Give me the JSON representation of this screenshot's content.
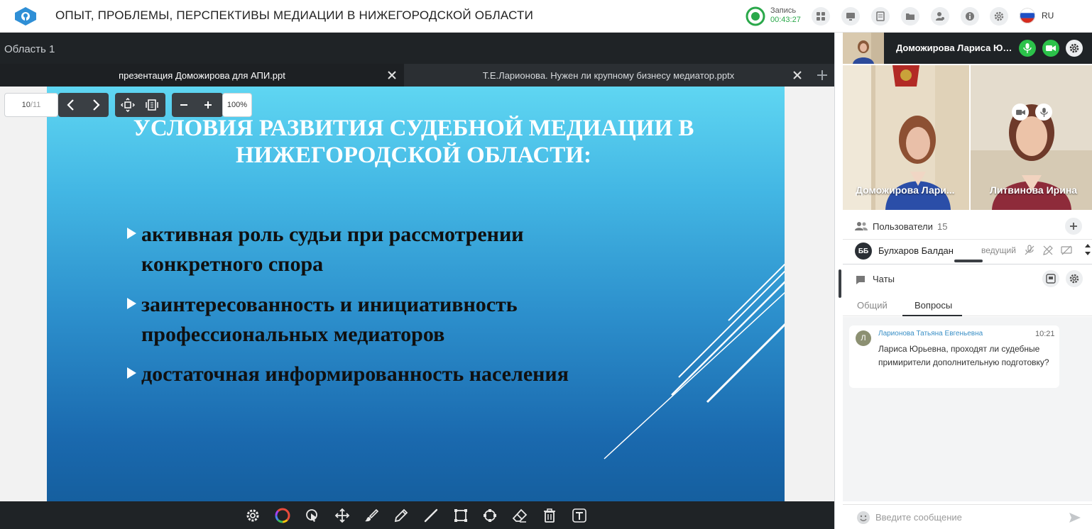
{
  "header": {
    "title": "ОПЫТ, ПРОБЛЕМЫ, ПЕРСПЕКТИВЫ МЕДИАЦИИ В НИЖЕГОРОДСКОЙ ОБЛАСТИ",
    "recording_label": "Запись",
    "recording_time": "00:43:27",
    "language": "RU",
    "icons": [
      "apps-icon",
      "screen-icon",
      "document-icon",
      "folder-icon",
      "user-settings-icon",
      "info-icon",
      "gear-icon"
    ],
    "accent_color": "#2aa84a"
  },
  "area": {
    "label": "Область 1"
  },
  "tabs": [
    {
      "label": "презентация Доможирова для АПИ.ppt",
      "active": true
    },
    {
      "label": "Т.Е.Ларионова. Нужен ли крупному бизнесу медиатор.pptx",
      "active": false
    }
  ],
  "slide_controls": {
    "page_current": "10",
    "page_total": "/11",
    "zoom": "100%"
  },
  "slide": {
    "title_line1": "УСЛОВИЯ РАЗВИТИЯ СУДЕБНОЙ МЕДИАЦИИ В",
    "title_line2": "НИЖЕГОРОДСКОЙ ОБЛАСТИ:",
    "bullets": [
      {
        "line1": "активная роль судьи при рассмотрении",
        "line2": "конкретного спора"
      },
      {
        "line1": "заинтересованность и инициативность",
        "line2": "профессиональных медиаторов"
      },
      {
        "line1": "достаточная информированность населения",
        "line2": ""
      }
    ]
  },
  "toolbar": {
    "tools": [
      "settings-tool",
      "color-tool",
      "pointer-tool",
      "move-tool",
      "brush-tool",
      "pen-tool",
      "line-tool",
      "rectangle-tool",
      "ellipse-tool",
      "eraser-tool",
      "trash-tool",
      "text-tool"
    ]
  },
  "speaker": {
    "name": "Доможирова Лариса Юрь..."
  },
  "videos": [
    {
      "name": "Доможирова Лари..."
    },
    {
      "name": "Литвинова Ирина"
    }
  ],
  "users": {
    "label": "Пользователи",
    "count": "15",
    "first_user": {
      "initials": "ББ",
      "name": "Булхаров Балдан",
      "role": "ведущий"
    }
  },
  "chats": {
    "label": "Чаты",
    "tabs": [
      {
        "label": "Общий",
        "active": false
      },
      {
        "label": "Вопросы",
        "active": true
      }
    ],
    "messages": [
      {
        "initial": "Л",
        "author": "Ларионова Татьяна Евгеньевна",
        "time": "10:21",
        "text": "Лариса Юрьевна, проходят ли судебные примирители дополнительную подготовку?"
      }
    ],
    "input_placeholder": "Введите сообщение"
  }
}
